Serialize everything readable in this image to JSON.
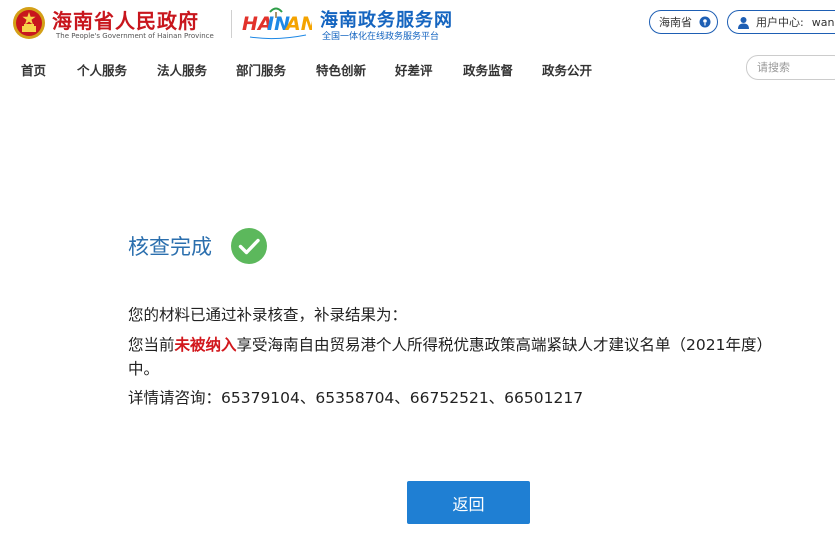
{
  "header": {
    "gov_name": "海南省人民政府",
    "gov_name_en": "The People's Government of Hainan Province",
    "hainan_logo_text": "HAINAN",
    "portal_name": "海南政务服务网",
    "portal_sub": "全国一体化在线政务服务平台",
    "region_label": "海南省",
    "user_center_label": "用户中心:",
    "user_name": "wang"
  },
  "nav": {
    "items": [
      "首页",
      "个人服务",
      "法人服务",
      "部门服务",
      "特色创新",
      "好差评",
      "政务监督",
      "政务公开"
    ],
    "search_placeholder": "请搜索"
  },
  "result": {
    "title": "核查完成",
    "line1": "您的材料已通过补录核查，补录结果为：",
    "line2_before": "您当前",
    "line2_highlight": "未被纳入",
    "line2_after": "享受海南自由贸易港个人所得税优惠政策高端紧缺人才建议名单（2021年度）中。",
    "line3": "详情请咨询：65379104、65358704、66752521、66501217",
    "back_label": "返回"
  },
  "colors": {
    "gov_red": "#c8161d",
    "portal_blue": "#1565c0",
    "title_blue": "#2b6fae",
    "success_green": "#5cb85c",
    "highlight_red": "#d2181d",
    "button_blue": "#1f7fd3"
  },
  "icons": {
    "emblem": "national-emblem-icon",
    "region_pin": "location-pin-icon",
    "user": "user-icon",
    "check": "check-circle-icon"
  }
}
